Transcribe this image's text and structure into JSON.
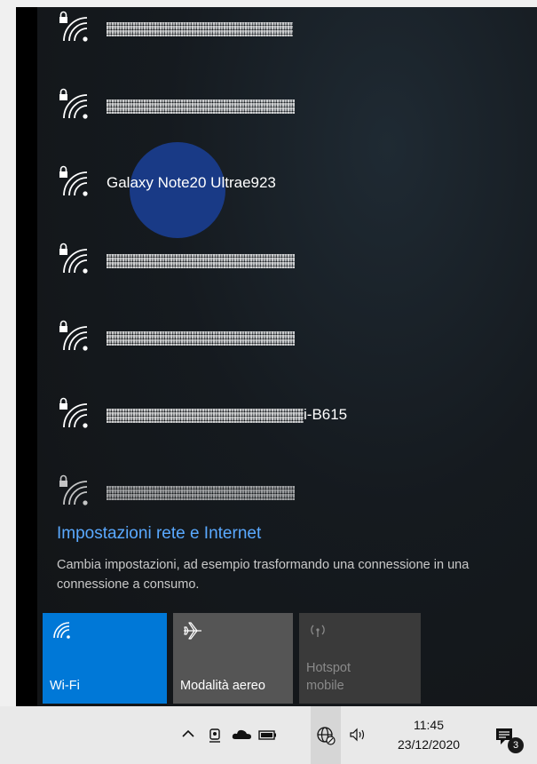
{
  "networks": [
    {
      "name_suffix": "",
      "obscured": true,
      "noise_width": 210
    },
    {
      "name_suffix": "",
      "obscured": true,
      "noise_width": 212
    },
    {
      "name": "Galaxy Note20 Ultrae923",
      "obscured": false
    },
    {
      "name_suffix": "",
      "obscured": true,
      "noise_width": 212
    },
    {
      "name_suffix": "",
      "obscured": true,
      "noise_width": 212
    },
    {
      "name_suffix": "i-B615",
      "obscured": true,
      "noise_width": 222
    },
    {
      "name_suffix": "",
      "obscured": true,
      "noise_width": 212
    }
  ],
  "settings": {
    "title": "Impostazioni rete e Internet",
    "description": "Cambia impostazioni, ad esempio trasformando una connessione in una connessione a consumo."
  },
  "quick_actions": {
    "wifi": {
      "label": "Wi-Fi",
      "active": true,
      "color": "#0078d7"
    },
    "airplane": {
      "label": "Modalità aereo",
      "active": false
    },
    "hotspot": {
      "label": "Hotspot\nmobile",
      "line1": "Hotspot",
      "line2": "mobile",
      "disabled": true
    }
  },
  "taskbar": {
    "time": "11:45",
    "date": "23/12/2020",
    "notification_count": "3",
    "tray_icons": [
      "chevron-up-icon",
      "meet-now-icon",
      "onedrive-cloud-icon",
      "battery-icon",
      "globe-network-icon",
      "speaker-icon",
      "action-center-icon"
    ]
  },
  "colors": {
    "accent": "#0078d7",
    "link": "#5aa9ff",
    "panel": "#151a1f"
  }
}
